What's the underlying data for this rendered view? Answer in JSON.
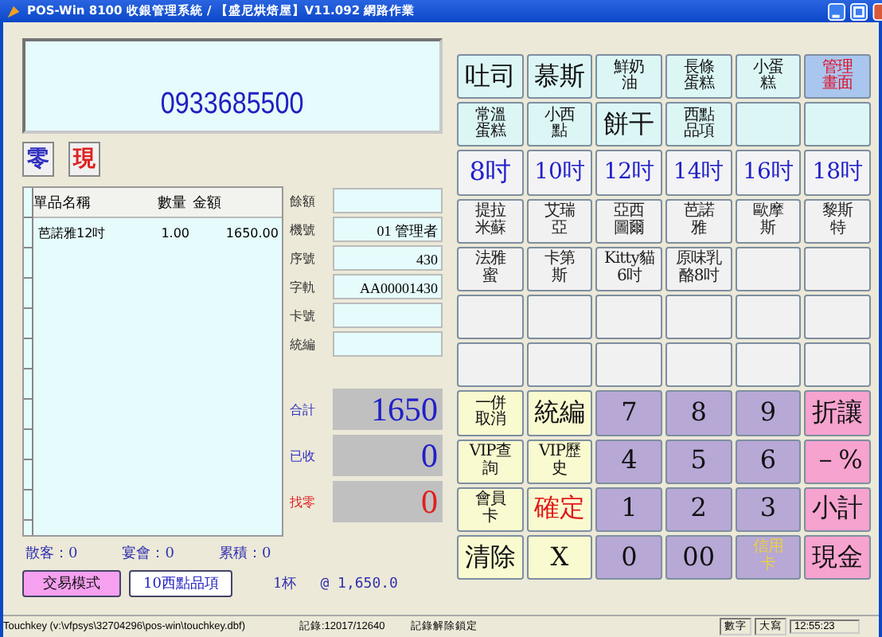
{
  "window": {
    "title": "POS-Win 8100 收銀管理系統 / 【盛尼烘焙屋】V11.092 網路作業"
  },
  "display": {
    "value": "0933685500"
  },
  "mode_buttons": [
    {
      "label": "零",
      "kind": "change"
    },
    {
      "label": "現",
      "kind": "cash"
    }
  ],
  "table": {
    "columns": [
      "單品名稱",
      "數量",
      "金額"
    ],
    "rows": [
      [
        "芭諾雅12吋",
        "1.00",
        "1650.00"
      ]
    ]
  },
  "info_fields": [
    {
      "label": "餘額"
    },
    {
      "label": "機號",
      "value": "01  管理者"
    },
    {
      "label": "序號",
      "value": "430"
    },
    {
      "label": "字軌",
      "value": "AA00001430"
    },
    {
      "label": "卡號"
    },
    {
      "label": "統編"
    }
  ],
  "totals": [
    {
      "label": "合計",
      "value": "1650",
      "kind": "total"
    },
    {
      "label": "已收",
      "value": "0",
      "kind": "paid"
    },
    {
      "label": "找零",
      "value": "0",
      "kind": "change"
    }
  ],
  "counters": [
    "散客：0",
    "宴會：0",
    "累積：0"
  ],
  "bottom_buttons": [
    {
      "label": "交易模式",
      "kind": "mode"
    },
    {
      "label": "10西點品項",
      "kind": "category"
    }
  ],
  "cup_count": "1杯",
  "unit_price": "@ 1,650.0",
  "keys": [
    {
      "lines": [
        "吐司"
      ],
      "kind": "item"
    },
    {
      "lines": [
        "慕斯"
      ],
      "kind": "item"
    },
    {
      "lines": [
        "鮮奶",
        "油"
      ],
      "kind": "item"
    },
    {
      "lines": [
        "長條",
        "蛋糕"
      ],
      "kind": "item"
    },
    {
      "lines": [
        "小蛋",
        "糕"
      ],
      "kind": "item"
    },
    {
      "lines": [
        "管理",
        "畫面"
      ],
      "kind": "admin"
    },
    {
      "lines": [
        "常溫",
        "蛋糕"
      ],
      "kind": "item"
    },
    {
      "lines": [
        "小西",
        "點"
      ],
      "kind": "item"
    },
    {
      "lines": [
        "餅干"
      ],
      "kind": "item"
    },
    {
      "lines": [
        "西點",
        "品項"
      ],
      "kind": "item"
    },
    {
      "kind": "item"
    },
    {
      "kind": "item"
    },
    {
      "lines": [
        "8吋"
      ],
      "kind": "size"
    },
    {
      "lines": [
        "10吋"
      ],
      "kind": "size"
    },
    {
      "lines": [
        "12吋"
      ],
      "kind": "size"
    },
    {
      "lines": [
        "14吋"
      ],
      "kind": "size"
    },
    {
      "lines": [
        "16吋"
      ],
      "kind": "size"
    },
    {
      "lines": [
        "18吋"
      ],
      "kind": "size"
    },
    {
      "lines": [
        "提拉",
        "米蘇"
      ],
      "kind": "product"
    },
    {
      "lines": [
        "艾瑞",
        "亞"
      ],
      "kind": "product"
    },
    {
      "lines": [
        "亞西",
        "圖爾"
      ],
      "kind": "product"
    },
    {
      "lines": [
        "芭諾",
        "雅"
      ],
      "kind": "product"
    },
    {
      "lines": [
        "歐摩",
        "斯"
      ],
      "kind": "product"
    },
    {
      "lines": [
        "黎斯",
        "特"
      ],
      "kind": "product"
    },
    {
      "lines": [
        "法雅",
        "蜜"
      ],
      "kind": "product"
    },
    {
      "lines": [
        "卡第",
        "斯"
      ],
      "kind": "product"
    },
    {
      "lines": [
        "Kitty貓",
        "6吋"
      ],
      "kind": "product"
    },
    {
      "lines": [
        "原味乳",
        "酪8吋"
      ],
      "kind": "product"
    },
    {
      "kind": "product"
    },
    {
      "kind": "product"
    },
    {
      "kind": "product"
    },
    {
      "kind": "product"
    },
    {
      "kind": "product"
    },
    {
      "kind": "product"
    },
    {
      "kind": "product"
    },
    {
      "kind": "product"
    },
    {
      "kind": "product"
    },
    {
      "kind": "product"
    },
    {
      "kind": "product"
    },
    {
      "kind": "product"
    },
    {
      "kind": "product"
    },
    {
      "kind": "product"
    },
    {
      "lines": [
        "一併",
        "取消"
      ],
      "kind": "function"
    },
    {
      "lines": [
        "統編"
      ],
      "kind": "function"
    },
    {
      "lines": [
        "7"
      ],
      "kind": "digit"
    },
    {
      "lines": [
        "8"
      ],
      "kind": "digit"
    },
    {
      "lines": [
        "9"
      ],
      "kind": "digit"
    },
    {
      "lines": [
        "折讓"
      ],
      "kind": "pay"
    },
    {
      "lines": [
        "VIP查",
        "詢"
      ],
      "kind": "function"
    },
    {
      "lines": [
        "VIP歷",
        "史"
      ],
      "kind": "function"
    },
    {
      "lines": [
        "4"
      ],
      "kind": "digit"
    },
    {
      "lines": [
        "5"
      ],
      "kind": "digit"
    },
    {
      "lines": [
        "6"
      ],
      "kind": "digit"
    },
    {
      "lines": [
        "－%"
      ],
      "kind": "pay"
    },
    {
      "lines": [
        "會員",
        "卡"
      ],
      "kind": "function"
    },
    {
      "lines": [
        "確定"
      ],
      "kind": "confirm"
    },
    {
      "lines": [
        "1"
      ],
      "kind": "digit"
    },
    {
      "lines": [
        "2"
      ],
      "kind": "digit"
    },
    {
      "lines": [
        "3"
      ],
      "kind": "digit"
    },
    {
      "lines": [
        "小計"
      ],
      "kind": "pay"
    },
    {
      "lines": [
        "清除"
      ],
      "kind": "function"
    },
    {
      "lines": [
        "X"
      ],
      "kind": "function"
    },
    {
      "lines": [
        "0"
      ],
      "kind": "digit"
    },
    {
      "lines": [
        "00"
      ],
      "kind": "digit"
    },
    {
      "lines": [
        "信用",
        "卡"
      ],
      "kind": "card"
    },
    {
      "lines": [
        "現金"
      ],
      "kind": "pay"
    }
  ],
  "status_bar": {
    "file": "Touchkey (v:\\vfpsys\\32704296\\pos-win\\touchkey.dbf)",
    "record": "記錄:12017/12640",
    "lock": "記錄解除鎖定",
    "indicators": [
      "數字",
      "大寫"
    ],
    "time": "12:55:23"
  }
}
